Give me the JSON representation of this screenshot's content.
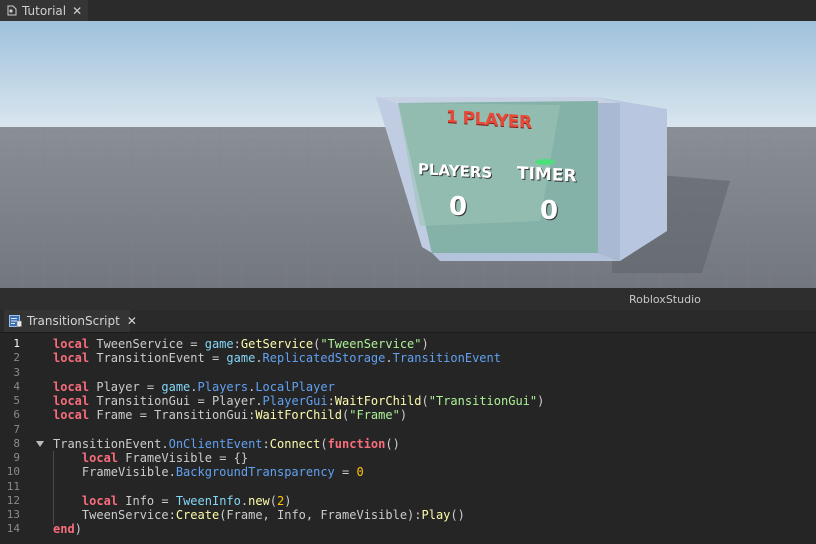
{
  "top_tab": {
    "title": "Tutorial",
    "close": "✕"
  },
  "viewport": {
    "board_title": "1 PLAYER",
    "players_label": "PLAYERS",
    "players_value": "0",
    "timer_label": "TIMER",
    "timer_value": "0"
  },
  "status": {
    "app_label": "RobloxStudio"
  },
  "script_tab": {
    "title": "TransitionScript",
    "close": "✕"
  },
  "editor": {
    "line_numbers": [
      "1",
      "2",
      "3",
      "4",
      "5",
      "6",
      "7",
      "8",
      "9",
      "10",
      "11",
      "12",
      "13",
      "14"
    ],
    "active_line": 1,
    "fold_marker_line": 8,
    "code": [
      [
        [
          "kw",
          "local"
        ],
        [
          "id",
          " TweenService "
        ],
        [
          "op",
          "= "
        ],
        [
          "gl",
          "game"
        ],
        [
          "op",
          ":"
        ],
        [
          "fn",
          "GetService"
        ],
        [
          "op",
          "("
        ],
        [
          "str",
          "\"TweenService\""
        ],
        [
          "op",
          ")"
        ]
      ],
      [
        [
          "kw",
          "local"
        ],
        [
          "id",
          " TransitionEvent "
        ],
        [
          "op",
          "= "
        ],
        [
          "gl",
          "game"
        ],
        [
          "op",
          "."
        ],
        [
          "prop",
          "ReplicatedStorage"
        ],
        [
          "op",
          "."
        ],
        [
          "prop",
          "TransitionEvent"
        ]
      ],
      [],
      [
        [
          "kw",
          "local"
        ],
        [
          "id",
          " Player "
        ],
        [
          "op",
          "= "
        ],
        [
          "gl",
          "game"
        ],
        [
          "op",
          "."
        ],
        [
          "prop",
          "Players"
        ],
        [
          "op",
          "."
        ],
        [
          "prop",
          "LocalPlayer"
        ]
      ],
      [
        [
          "kw",
          "local"
        ],
        [
          "id",
          " TransitionGui "
        ],
        [
          "op",
          "= "
        ],
        [
          "id",
          "Player"
        ],
        [
          "op",
          "."
        ],
        [
          "prop",
          "PlayerGui"
        ],
        [
          "op",
          ":"
        ],
        [
          "fn",
          "WaitForChild"
        ],
        [
          "op",
          "("
        ],
        [
          "str",
          "\"TransitionGui\""
        ],
        [
          "op",
          ")"
        ]
      ],
      [
        [
          "kw",
          "local"
        ],
        [
          "id",
          " Frame "
        ],
        [
          "op",
          "= "
        ],
        [
          "id",
          "TransitionGui"
        ],
        [
          "op",
          ":"
        ],
        [
          "fn",
          "WaitForChild"
        ],
        [
          "op",
          "("
        ],
        [
          "str",
          "\"Frame\""
        ],
        [
          "op",
          ")"
        ]
      ],
      [],
      [
        [
          "id",
          "TransitionEvent"
        ],
        [
          "op",
          "."
        ],
        [
          "prop",
          "OnClientEvent"
        ],
        [
          "op",
          ":"
        ],
        [
          "fn",
          "Connect"
        ],
        [
          "op",
          "("
        ],
        [
          "kw",
          "function"
        ],
        [
          "op",
          "()"
        ]
      ],
      [
        [
          "id",
          "    "
        ],
        [
          "kw",
          "local"
        ],
        [
          "id",
          " FrameVisible "
        ],
        [
          "op",
          "= {}"
        ]
      ],
      [
        [
          "id",
          "    FrameVisible"
        ],
        [
          "op",
          "."
        ],
        [
          "prop",
          "BackgroundTransparency"
        ],
        [
          "op",
          " = "
        ],
        [
          "num",
          "0"
        ]
      ],
      [],
      [
        [
          "id",
          "    "
        ],
        [
          "kw",
          "local"
        ],
        [
          "id",
          " Info "
        ],
        [
          "op",
          "= "
        ],
        [
          "gl",
          "TweenInfo"
        ],
        [
          "op",
          "."
        ],
        [
          "fn",
          "new"
        ],
        [
          "op",
          "("
        ],
        [
          "num",
          "2"
        ],
        [
          "op",
          ")"
        ]
      ],
      [
        [
          "id",
          "    TweenService"
        ],
        [
          "op",
          ":"
        ],
        [
          "fn",
          "Create"
        ],
        [
          "op",
          "("
        ],
        [
          "id",
          "Frame, Info, FrameVisible"
        ],
        [
          "op",
          "):"
        ],
        [
          "fn",
          "Play"
        ],
        [
          "op",
          "()"
        ]
      ],
      [
        [
          "kw",
          "end"
        ],
        [
          "op",
          ")"
        ]
      ]
    ]
  }
}
